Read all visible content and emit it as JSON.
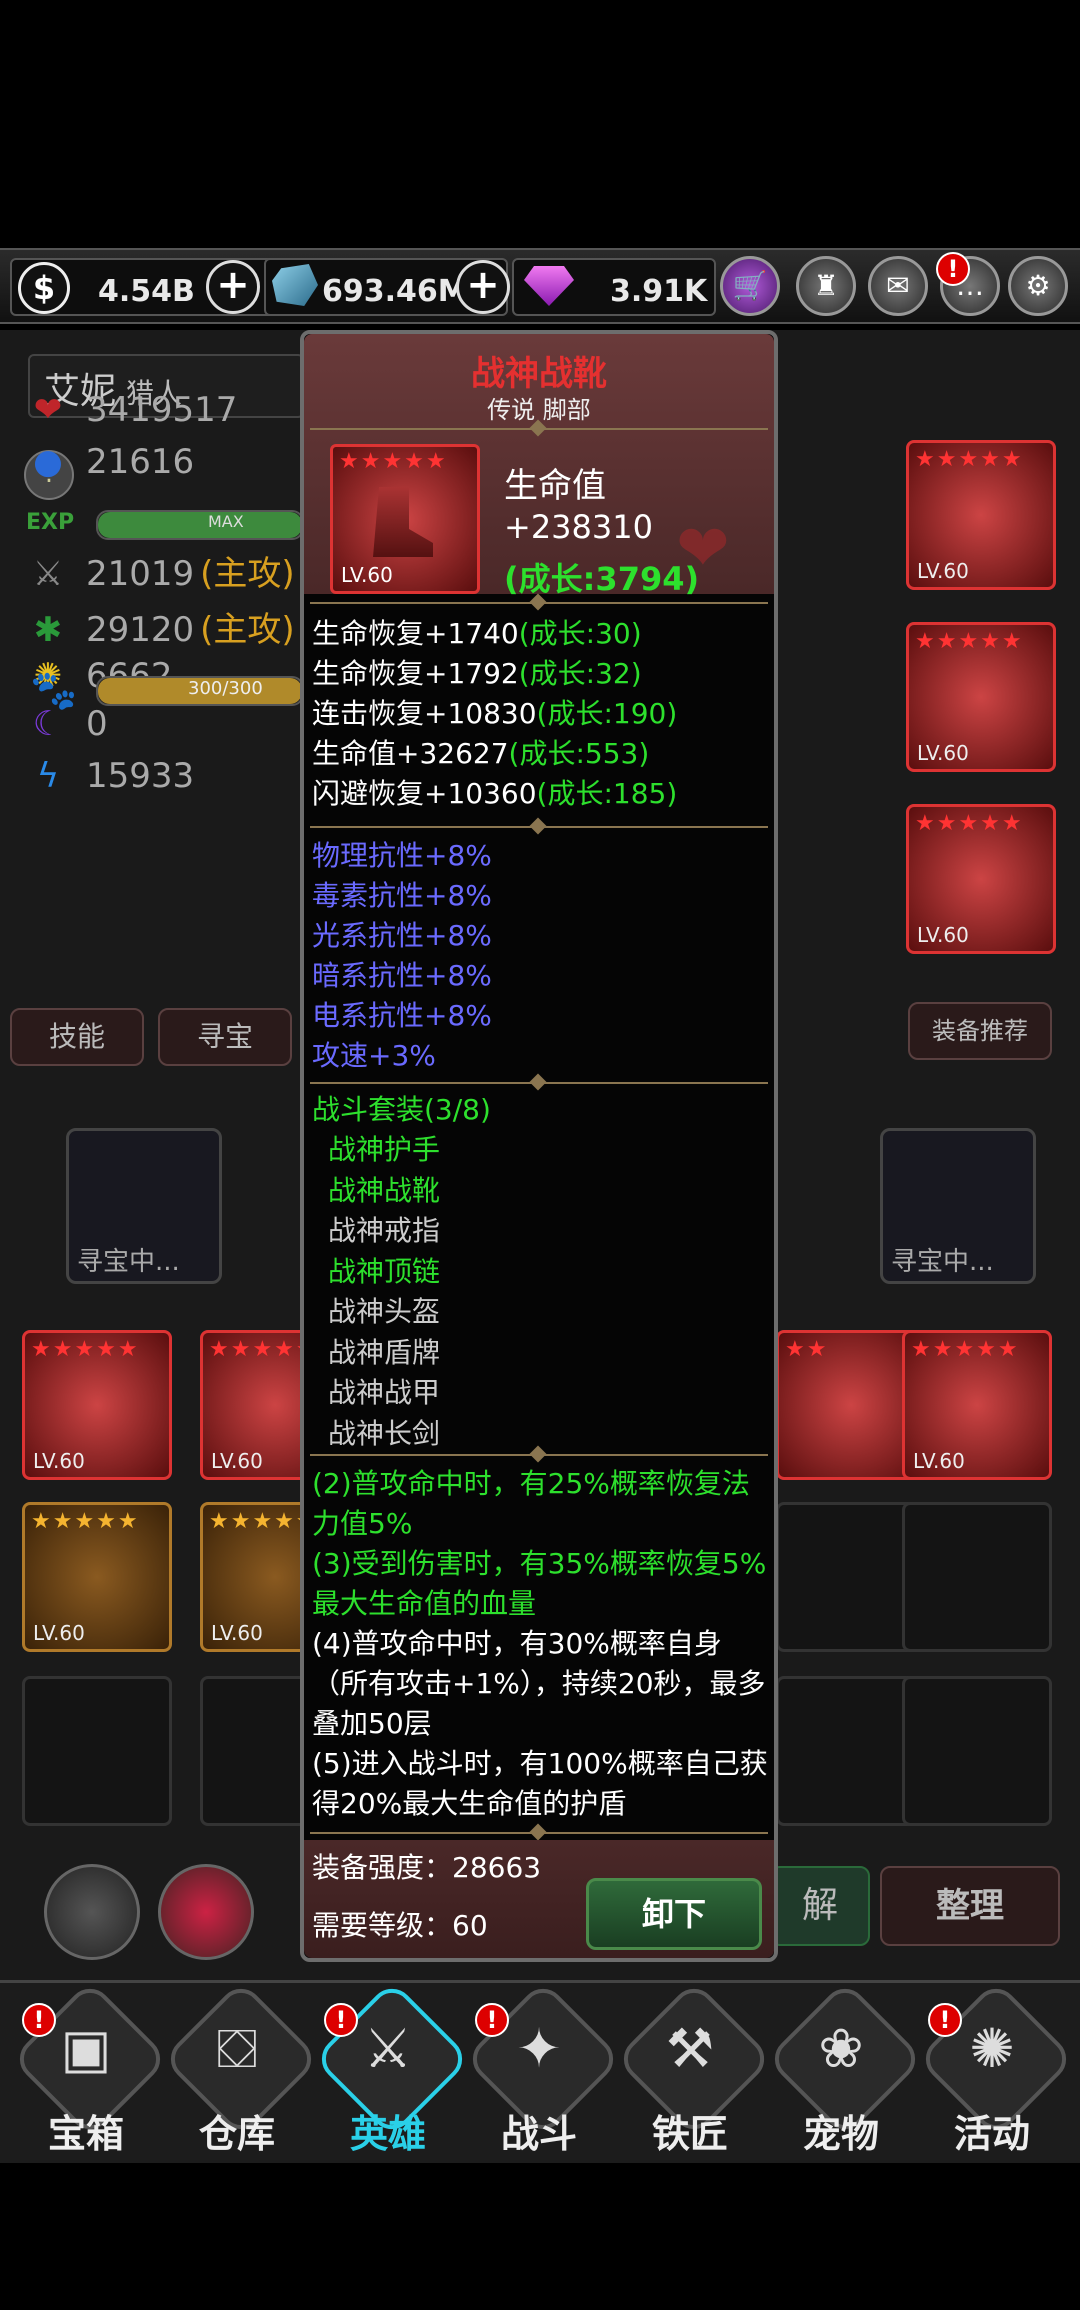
{
  "topbar": {
    "gold": "4.54B",
    "crystal": "693.46M",
    "gems": "3.91K"
  },
  "hero": {
    "name": "艾妮",
    "class": "猎人",
    "exp_label": "EXP",
    "exp_bar": "MAX",
    "exp_fill": 1.0,
    "pet_bar": "300/300",
    "pet_fill": 1.0,
    "stats": [
      {
        "icon": "heart-icon",
        "glyph": "❤",
        "color": "#c0252a",
        "value": "3419517",
        "tag": ""
      },
      {
        "icon": "mana-drop-icon",
        "glyph": "●",
        "color": "#2a6ad8",
        "value": "21616",
        "tag": ""
      },
      {
        "icon": "sword-icon",
        "glyph": "⚔",
        "color": "#888888",
        "value": "21019",
        "tag": "(主攻)"
      },
      {
        "icon": "green-splat-icon",
        "glyph": "✱",
        "color": "#2a9a3a",
        "value": "29120",
        "tag": "(主攻)"
      },
      {
        "icon": "sun-icon",
        "glyph": "✺",
        "color": "#e8c020",
        "value": "6662",
        "tag": ""
      },
      {
        "icon": "moon-icon",
        "glyph": "☾",
        "color": "#7a3ad8",
        "value": "0",
        "tag": ""
      },
      {
        "icon": "lightning-icon",
        "glyph": "ϟ",
        "color": "#2a8ae8",
        "value": "15933",
        "tag": ""
      }
    ],
    "buttons": {
      "skill": "技能",
      "treasure": "寻宝",
      "recommend": "装备推荐",
      "sort": "整理"
    },
    "treasure_slots": [
      "寻宝中...",
      "寻宝中..."
    ]
  },
  "tooltip": {
    "item_name": "战神战靴",
    "rarity_slot": "传说  脚部",
    "level": "LV.60",
    "main_stat_label": "生命值",
    "main_stat_value": "+238310",
    "main_stat_growth": "(成长:3794)",
    "sub_stats": [
      {
        "text": "生命恢复+1740",
        "growth": "(成长:30)"
      },
      {
        "text": "生命恢复+1792",
        "growth": "(成长:32)"
      },
      {
        "text": "连击恢复+10830",
        "growth": "(成长:190)"
      },
      {
        "text": "生命值+32627",
        "growth": "(成长:553)"
      },
      {
        "text": "闪避恢复+10360",
        "growth": "(成长:185)"
      }
    ],
    "resists": [
      "物理抗性+8%",
      "毒素抗性+8%",
      "光系抗性+8%",
      "暗系抗性+8%",
      "电系抗性+8%",
      "攻速+3%"
    ],
    "set_title": "战斗套装(3/8)",
    "set_items": [
      {
        "name": "战神护手",
        "owned": true
      },
      {
        "name": "战神战靴",
        "owned": true
      },
      {
        "name": "战神戒指",
        "owned": false
      },
      {
        "name": "战神顶链",
        "owned": true
      },
      {
        "name": "战神头盔",
        "owned": false
      },
      {
        "name": "战神盾牌",
        "owned": false
      },
      {
        "name": "战神战甲",
        "owned": false
      },
      {
        "name": "战神长剑",
        "owned": false
      }
    ],
    "set_bonuses": [
      {
        "text": " (2)普攻命中时，有25%概率恢复法力值5%",
        "active": true
      },
      {
        "text": " (3)受到伤害时，有35%概率恢复5%最大生命值的血量",
        "active": true
      },
      {
        "text": " (4)普攻命中时，有30%概率自身（所有攻击+1%），持续20秒，最多叠加50层",
        "active": false
      },
      {
        "text": " (5)进入战斗时，有100%概率自己获得20%最大生命值的护盾",
        "active": false
      }
    ],
    "power_label": "装备强度：",
    "power_value": "28663",
    "req_label": "需要等级：",
    "req_value": "60",
    "unequip": "卸下"
  },
  "nav": [
    {
      "label": "宝箱",
      "icon": "chest-icon",
      "glyph": "▣",
      "alert": true,
      "active": false
    },
    {
      "label": "仓库",
      "icon": "backpack-icon",
      "glyph": "⛋",
      "alert": false,
      "active": false
    },
    {
      "label": "英雄",
      "icon": "hero-sword-icon",
      "glyph": "⚔",
      "alert": true,
      "active": true
    },
    {
      "label": "战斗",
      "icon": "battle-icon",
      "glyph": "✦",
      "alert": true,
      "active": false
    },
    {
      "label": "铁匠",
      "icon": "anvil-icon",
      "glyph": "⚒",
      "alert": false,
      "active": false
    },
    {
      "label": "宠物",
      "icon": "pet-icon",
      "glyph": "❀",
      "alert": false,
      "active": false
    },
    {
      "label": "活动",
      "icon": "event-icon",
      "glyph": "✺",
      "alert": true,
      "active": false
    }
  ],
  "colors": {
    "accent": "#2ad0e8",
    "legend_red": "#e53030",
    "set_green": "#2de02d",
    "resist_blue": "#6a6aff"
  }
}
